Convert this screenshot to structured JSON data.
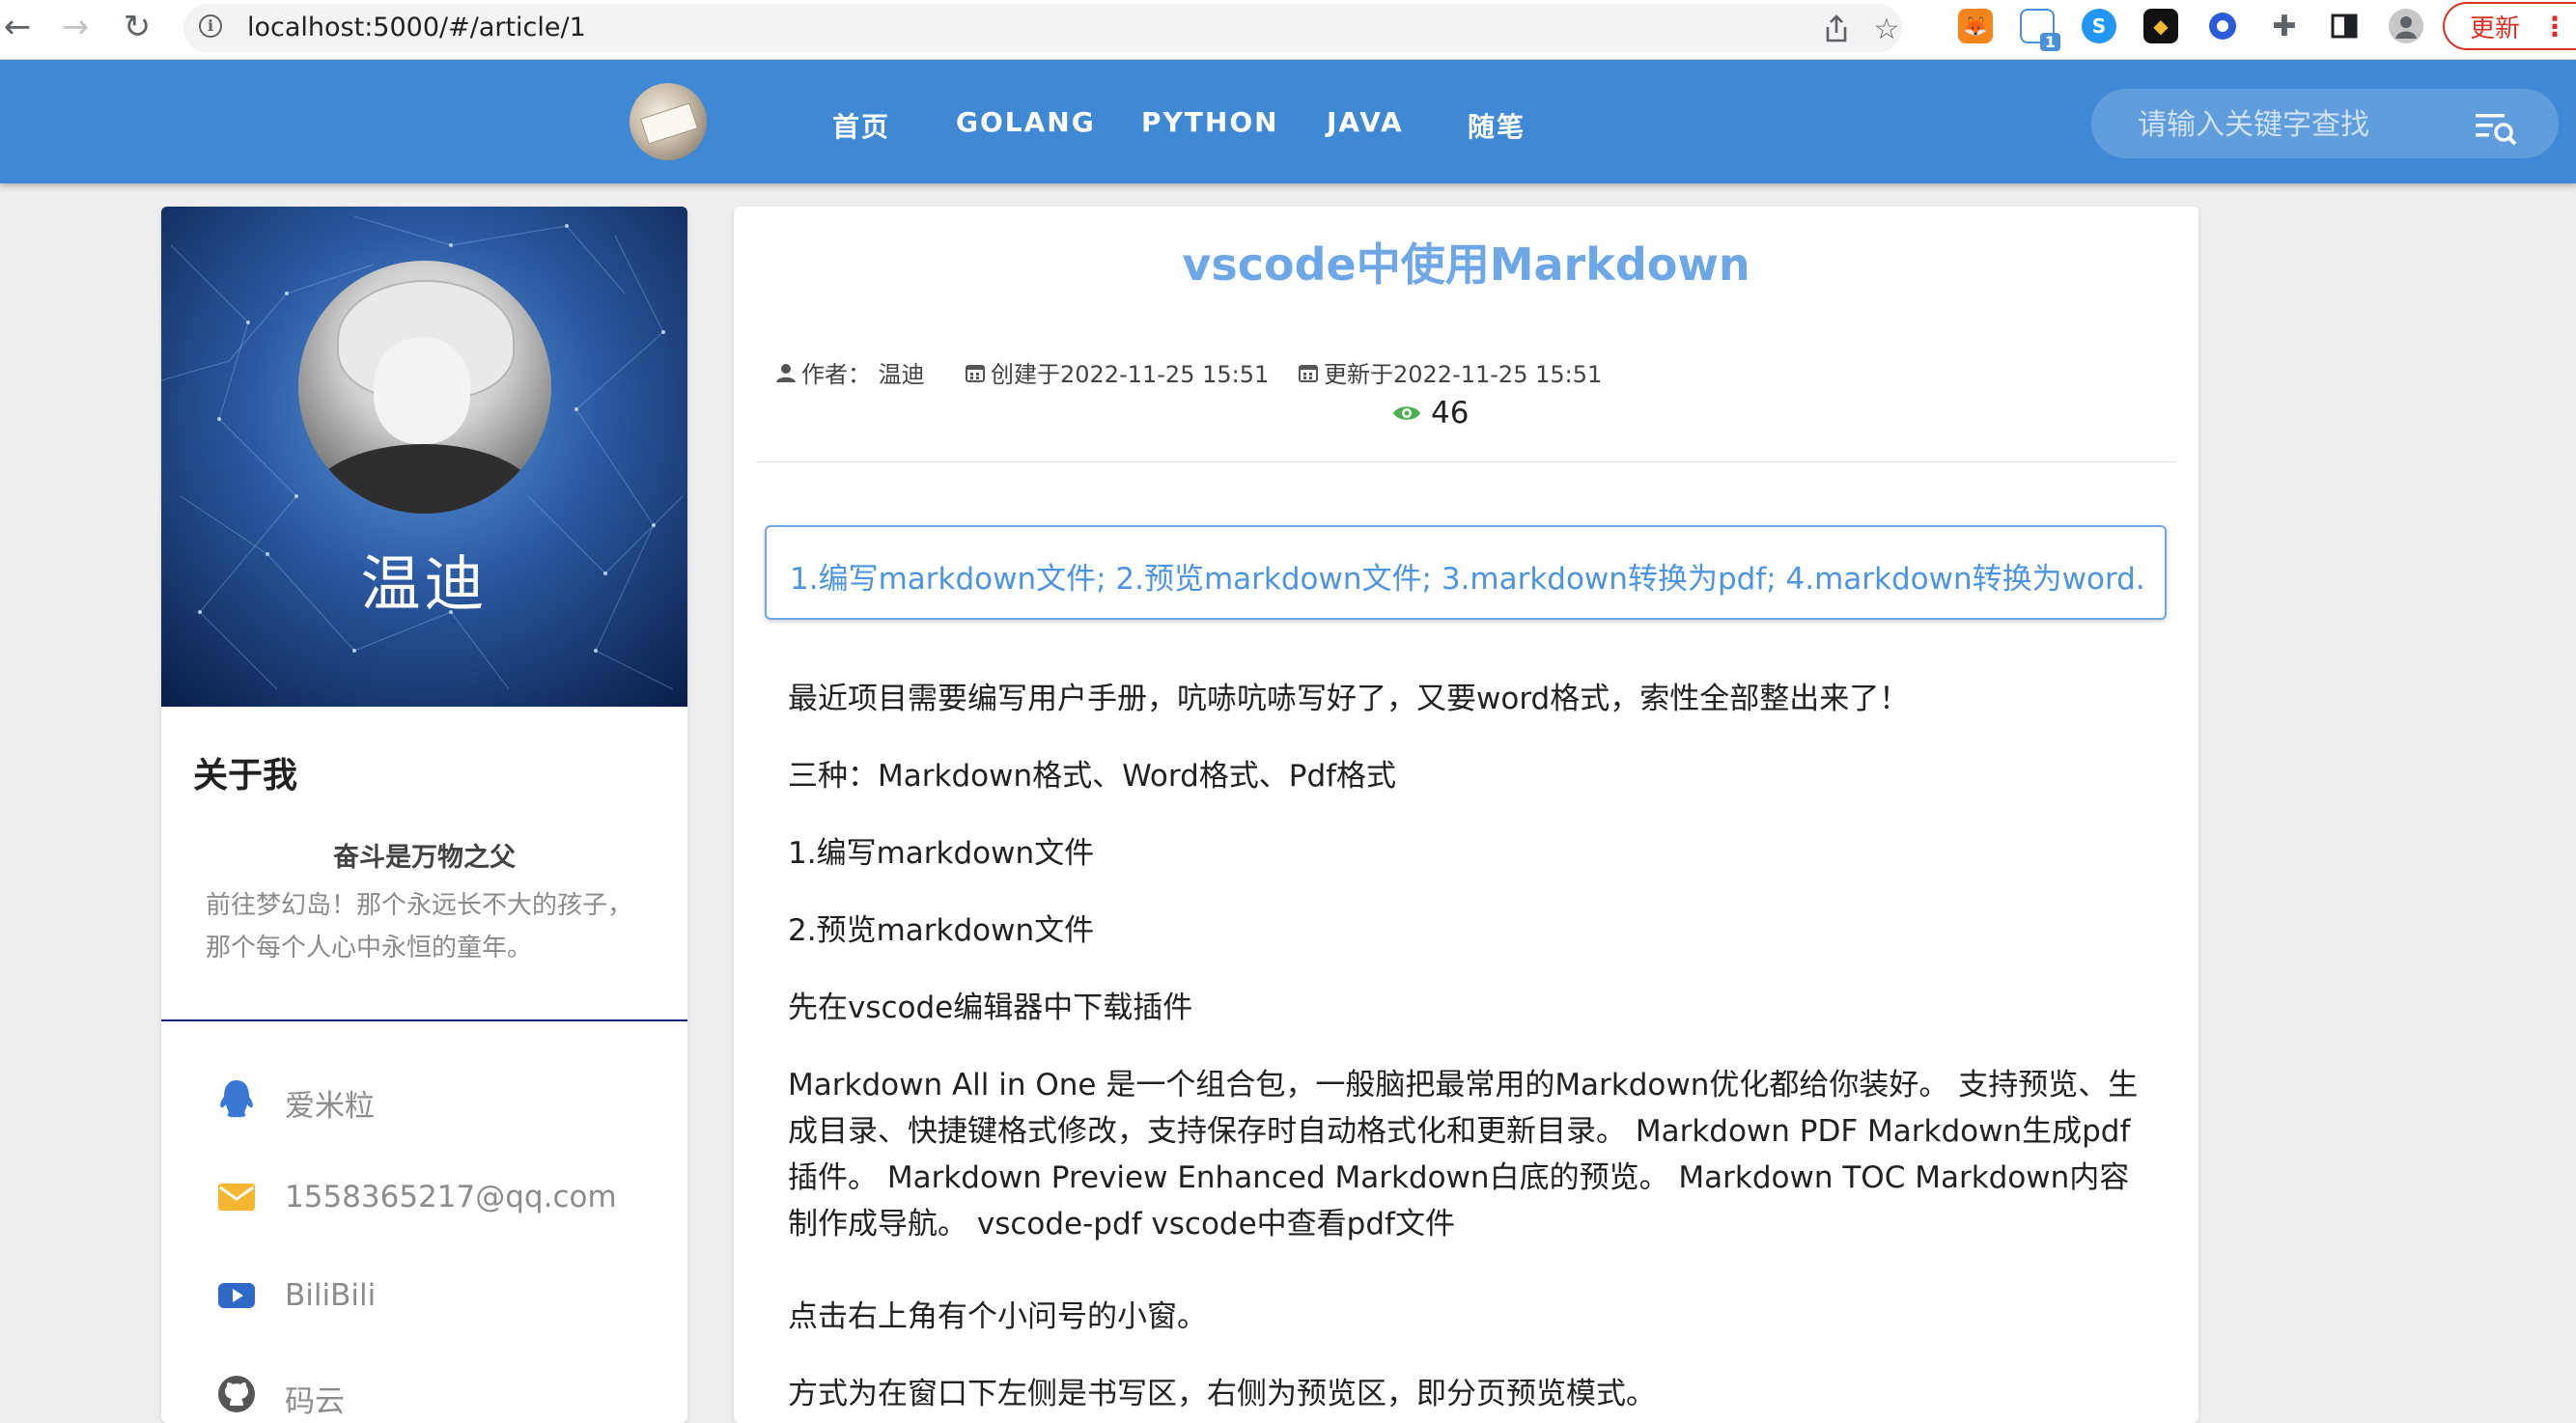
{
  "browser": {
    "url": "localhost:5000/#/article/1",
    "update_label": "更新",
    "extension_badge": "1"
  },
  "header": {
    "menu": [
      "首页",
      "GOLANG",
      "PYTHON",
      "JAVA",
      "随笔"
    ],
    "search_placeholder": "请输入关键字查找"
  },
  "profile": {
    "name": "温迪",
    "about_title": "关于我",
    "motto": "奋斗是万物之父",
    "description": "前往梦幻岛！那个永远长不大的孩子，那个每个人心中永恒的童年。",
    "contacts": [
      {
        "label": "爱米粒",
        "icon": "qq-icon"
      },
      {
        "label": "1558365217@qq.com",
        "icon": "email-icon"
      },
      {
        "label": "BiliBili",
        "icon": "youtube-icon"
      },
      {
        "label": "码云",
        "icon": "github-icon"
      }
    ]
  },
  "article": {
    "title": "vscode中使用Markdown",
    "author": "作者：  温迪",
    "created": "创建于2022-11-25 15:51",
    "updated": "更新于2022-11-25 15:51",
    "views": "46",
    "summary": "1.编写markdown文件; 2.预览markdown文件; 3.markdown转换为pdf; 4.markdown转换为word.",
    "paragraphs": [
      "最近项目需要编写用户手册，吭哧吭哧写好了，又要word格式，索性全部整出来了！",
      "三种：Markdown格式、Word格式、Pdf格式",
      "1.编写markdown文件",
      "2.预览markdown文件",
      "先在vscode编辑器中下载插件",
      "Markdown All in One 是一个组合包，一般脑把最常用的Markdown优化都给你装好。 支持预览、生成目录、快捷键格式修改，支持保存时自动格式化和更新目录。 Markdown PDF Markdown生成pdf插件。 Markdown Preview Enhanced Markdown白底的预览。 Markdown TOC Markdown内容制作成导航。 vscode-pdf vscode中查看pdf文件",
      "点击右上角有个小问号的小窗。",
      "方式为在窗口下左侧是书写区，右侧为预览区，即分页预览模式。"
    ]
  },
  "colors": {
    "appbar": "#3f88d4",
    "title": "#6ea7e6",
    "summary_text": "#4d94e0",
    "divider": "#1a237e"
  }
}
